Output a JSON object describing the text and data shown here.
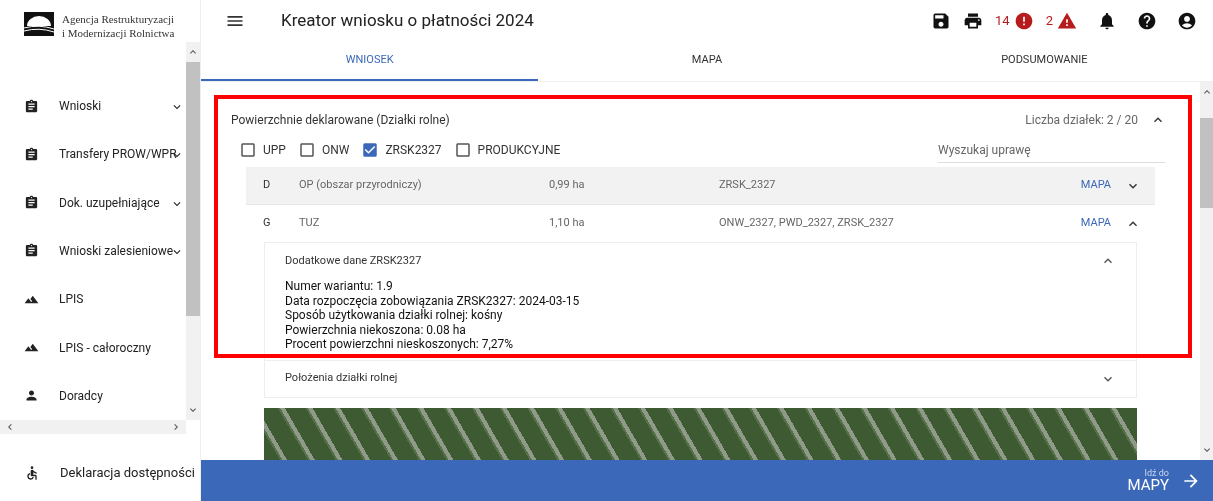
{
  "logo": {
    "line1": "Agencja Restrukturyzacji",
    "line2": "i Modernizacji Rolnictwa"
  },
  "header": {
    "title": "Kreator wniosku o płatności 2024",
    "error_count": "14",
    "warning_count": "2"
  },
  "sidebar": {
    "items": [
      {
        "label": "Wnioski",
        "expandable": true
      },
      {
        "label": "Transfery PROW/WPR",
        "expandable": true
      },
      {
        "label": "Dok. uzupełniające",
        "expandable": true
      },
      {
        "label": "Wnioski zalesieniowe",
        "expandable": true
      },
      {
        "label": "LPIS",
        "expandable": false
      },
      {
        "label": "LPIS - całoroczny",
        "expandable": false
      },
      {
        "label": "Doradcy",
        "expandable": false
      }
    ],
    "footer_item": {
      "label": "Deklaracja dostępności"
    }
  },
  "tabs": [
    {
      "label": "WNIOSEK",
      "selected": true
    },
    {
      "label": "MAPA",
      "selected": false
    },
    {
      "label": "PODSUMOWANIE",
      "selected": false
    }
  ],
  "section": {
    "title": "Powierzchnie deklarowane (Działki rolne)",
    "count": "Liczba działek: 2 / 20",
    "expanded": true,
    "filters": [
      {
        "label": "UPP",
        "checked": false
      },
      {
        "label": "ONW",
        "checked": false
      },
      {
        "label": "ZRSK2327",
        "checked": true
      },
      {
        "label": "PRODUKCYJNE",
        "checked": false
      }
    ],
    "search": {
      "placeholder": "Wyszukaj uprawę"
    },
    "rows": [
      {
        "code": "D",
        "crop": "OP (obszar przyrodniczy)",
        "area": "0,99 ha",
        "programs": "ZRSK_2327",
        "link": "MAPA",
        "expanded": false
      },
      {
        "code": "G",
        "crop": "TUZ",
        "area": "1,10 ha",
        "programs": "ONW_2327, PWD_2327, ZRSK_2327",
        "link": "MAPA",
        "expanded": true,
        "panels": [
          {
            "title": "Dodatkowe dane ZRSK2327",
            "expanded": true,
            "lines": [
              "Numer wariantu: 1.9",
              "Data rozpoczęcia zobowiązania ZRSK2327: 2024-03-15",
              "Sposób użytkowania działki rolnej: kośny",
              "Powierzchnia niekoszona: 0.08 ha",
              "Procent powierzchni nieskoszonych: 7,27%"
            ]
          },
          {
            "title": "Położenia działki rolnej",
            "expanded": false
          }
        ]
      }
    ]
  },
  "footer": {
    "caption": "Idź do",
    "action": "MAPY"
  }
}
